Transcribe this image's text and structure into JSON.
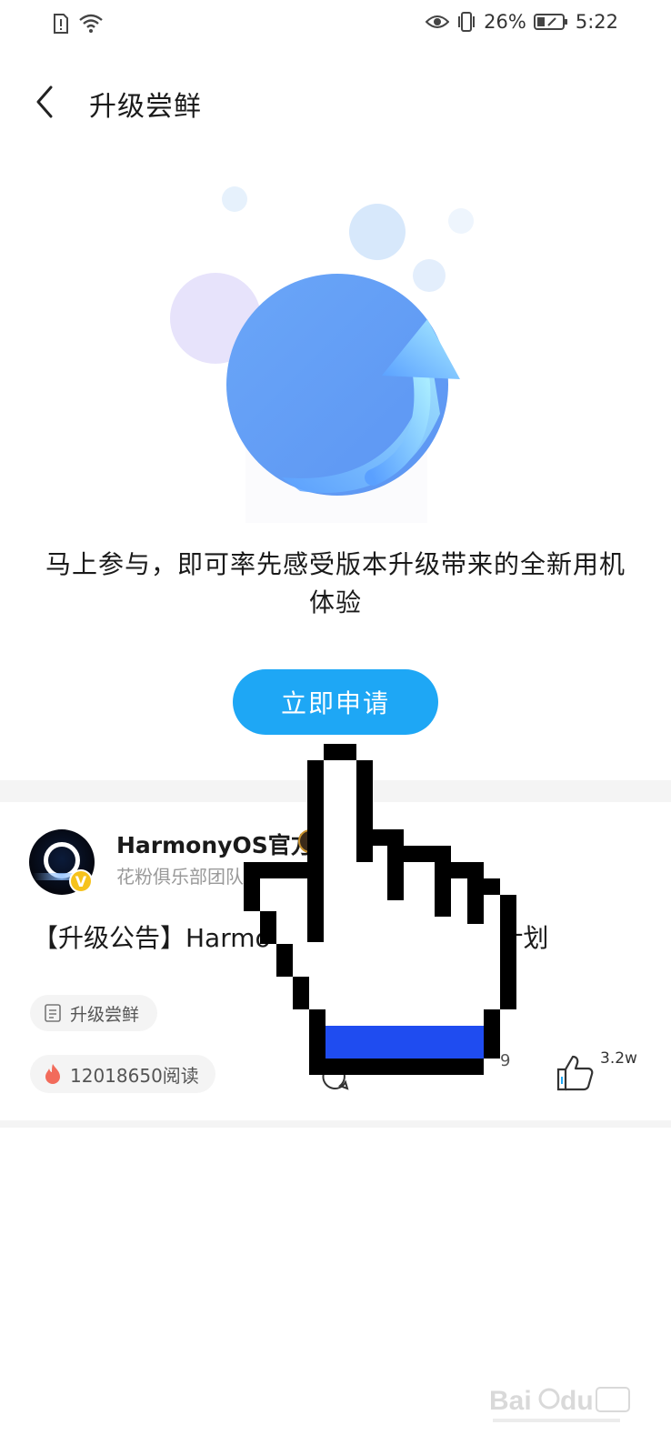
{
  "status_bar": {
    "battery": "26%",
    "time": "5:22"
  },
  "header": {
    "title": "升级尝鲜"
  },
  "intro": {
    "text": "马上参与，即可率先感受版本升级带来的全新用机体验"
  },
  "apply_button": {
    "label": "立即申请"
  },
  "post": {
    "author_name": "HarmonyOS官方",
    "author_team": "花粉俱乐部团队",
    "verify_badge": "V",
    "title": "【升级公告】HarmonyOS 2 正式版升级计划",
    "topic_tag": "升级尝鲜",
    "read_count": "12018650阅读",
    "comment_count": "9",
    "like_count": "3.2w"
  },
  "colors": {
    "accent": "#1ea7f5",
    "cursor_blue": "#1f4cf0"
  }
}
